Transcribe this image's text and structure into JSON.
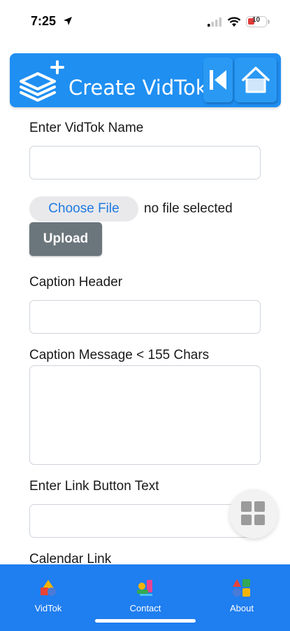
{
  "status_bar": {
    "time": "7:25",
    "battery_level": "10"
  },
  "header": {
    "title": "Create VidTok",
    "logo_icon": "stack-plus-icon",
    "back_icon": "skip-back-icon",
    "home_icon": "home-icon"
  },
  "form": {
    "name_label": "Enter VidTok Name",
    "name_value": "",
    "choose_file_label": "Choose File",
    "file_status": "no file selected",
    "upload_label": "Upload",
    "caption_header_label": "Caption Header",
    "caption_header_value": "",
    "caption_message_label": "Caption Message < 155 Chars",
    "caption_message_value": "",
    "link_button_label": "Enter Link Button Text",
    "link_button_value": "",
    "calendar_link_label": "Calendar Link"
  },
  "fab": {
    "icon": "grid-icon"
  },
  "bottom_nav": {
    "items": [
      {
        "label": "VidTok",
        "icon": "shapes-icon"
      },
      {
        "label": "Contact",
        "icon": "contact-icon"
      },
      {
        "label": "About",
        "icon": "about-shapes-icon"
      }
    ]
  },
  "colors": {
    "header_blue": "#1f8ff2",
    "nav_blue": "#1f7ef0",
    "upload_gray": "#6b757c",
    "link_blue": "#1f7ae0"
  }
}
